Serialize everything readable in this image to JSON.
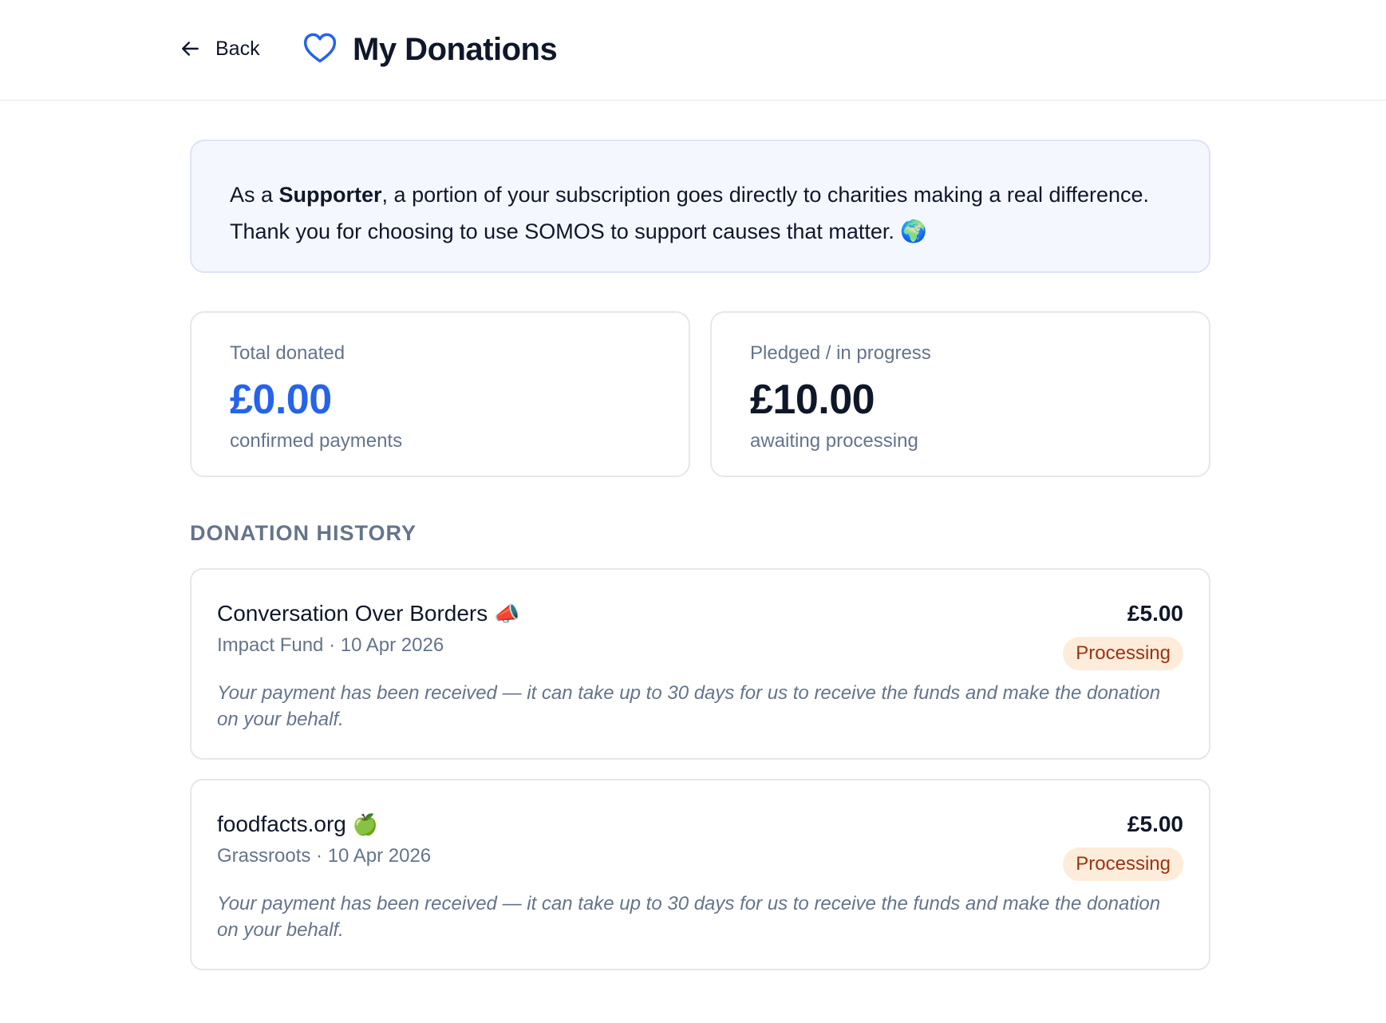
{
  "header": {
    "back_label": "Back",
    "title": "My Donations",
    "heart_icon_color": "#2563eb"
  },
  "intro": {
    "prefix": "As a ",
    "role": "Supporter",
    "suffix": ", a portion of your subscription goes directly to charities making a real difference. Thank you for choosing to use SOMOS to support causes that matter. 🌍"
  },
  "stats": {
    "total": {
      "label": "Total donated",
      "value": "£0.00",
      "sub": "confirmed payments",
      "color": "#2563eb"
    },
    "pledged": {
      "label": "Pledged / in progress",
      "value": "£10.00",
      "sub": "awaiting processing"
    }
  },
  "history": {
    "title": "DONATION HISTORY",
    "items": [
      {
        "name": "Conversation Over Borders",
        "emoji": "📣",
        "meta": "Impact Fund · 10 Apr 2026",
        "amount": "£5.00",
        "status": "Processing",
        "note": "Your payment has been received — it can take up to 30 days for us to receive the funds and make the donation on your behalf."
      },
      {
        "name": "foodfacts.org",
        "emoji": "🍏",
        "meta": "Grassroots · 10 Apr 2026",
        "amount": "£5.00",
        "status": "Processing",
        "note": "Your payment has been received — it can take up to 30 days for us to receive the funds and make the donation on your behalf."
      }
    ],
    "status_badge_bg": "#fdecd9",
    "status_badge_text": "#9a3412"
  }
}
